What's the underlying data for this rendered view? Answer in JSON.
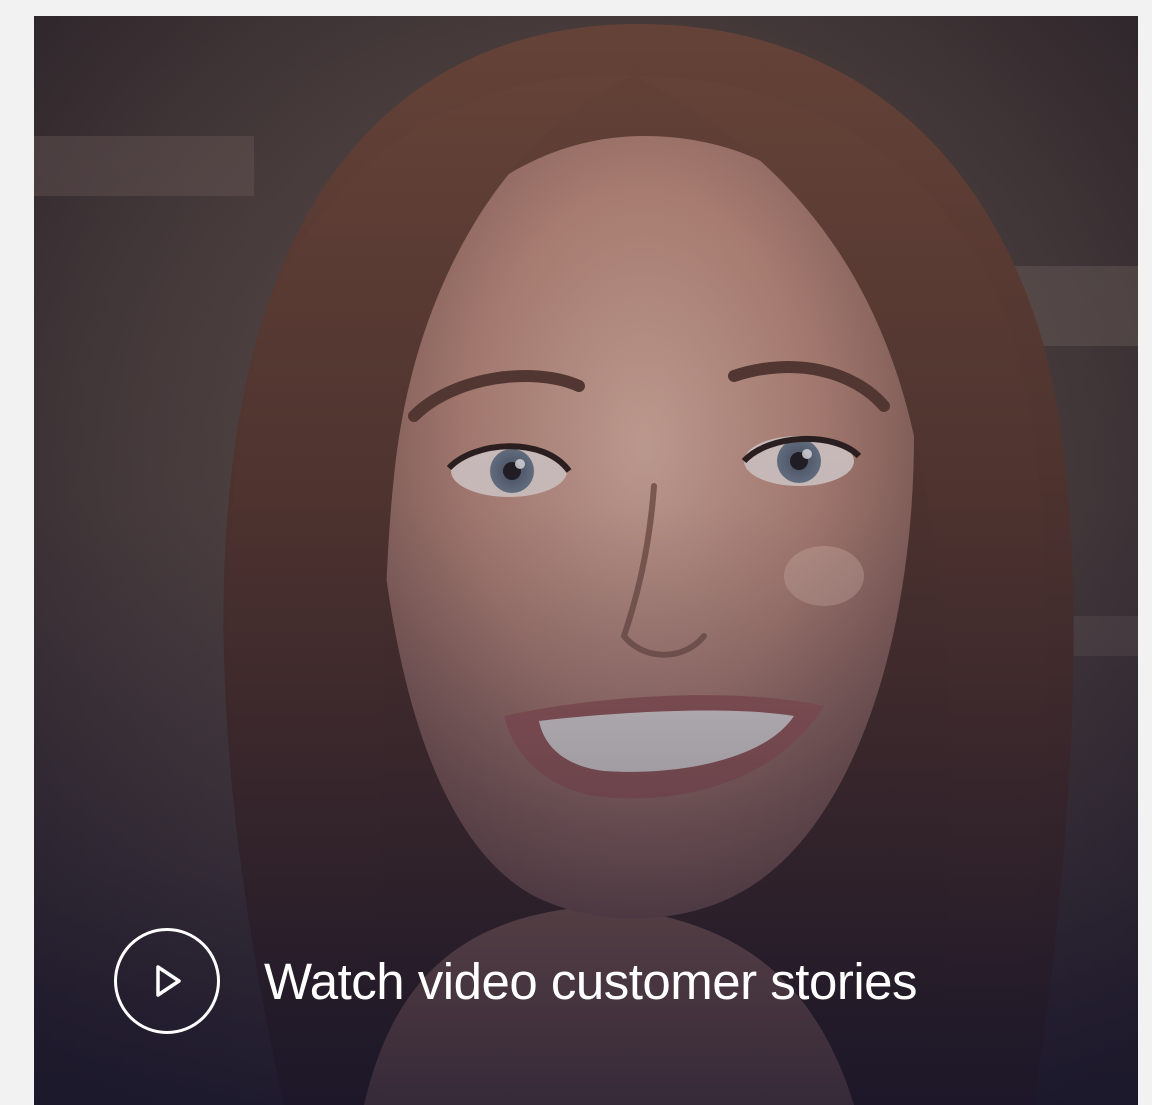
{
  "video_card": {
    "image_alt": "Smiling woman with long brown hair",
    "cta_label": "Watch video customer stories",
    "cta_icon": "play-icon",
    "colors": {
      "page_background": "#f3f2f3",
      "overlay_tint": "#1e1a34",
      "text": "#ffffff"
    }
  }
}
